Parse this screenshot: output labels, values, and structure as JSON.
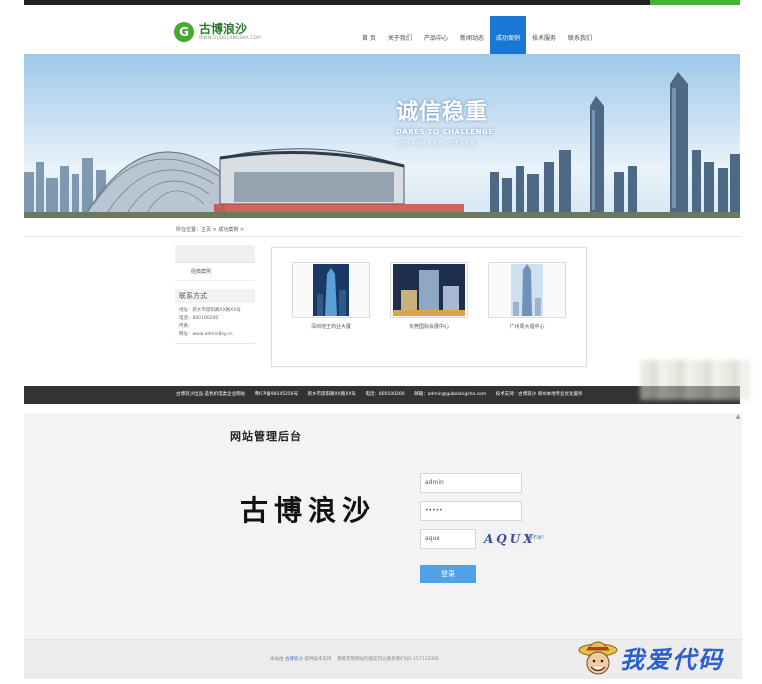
{
  "site": {
    "logo": {
      "cn": "古博浪沙",
      "en": "WWW.GUBOLANGSHA.COM",
      "mark": "G"
    },
    "nav": [
      {
        "label": "首 页",
        "active": false
      },
      {
        "label": "关于我们",
        "active": false
      },
      {
        "label": "产品中心",
        "active": false
      },
      {
        "label": "新闻动态",
        "active": false
      },
      {
        "label": "成功案例",
        "active": true
      },
      {
        "label": "技术服务",
        "active": false
      },
      {
        "label": "联系我们",
        "active": false
      }
    ],
    "banner": {
      "slogan_cn": "诚信稳重",
      "slogan_en": "DARES TO CHALLENGE",
      "tags": "• 合作 • 团结 • 发展 • 交流 • 共赢"
    },
    "breadcrumb": "所在位置：主页 > 成功案例 >",
    "sidebar": {
      "category": "经典案例",
      "contact_title": "联系方式",
      "contact_lines": [
        "地址：新乡市席阳路XX路XX号",
        "电话：800100200",
        "传真：",
        "网址：www.admin8sy.cn"
      ]
    },
    "cases": [
      {
        "caption": "深圳地王商业大厦"
      },
      {
        "caption": "东莞国际会展中心"
      },
      {
        "caption": "广州周大福中心"
      }
    ],
    "footer": [
      "古博浪沙出品-蓝色机电类企业网站",
      "粤ICP备98545256号",
      "新乡市席阳路XX路XX号",
      "电话：800100200",
      "邮箱：admin@gubolangsha.com",
      "技术支持：古博浪沙 郑州本地专业优化服务"
    ]
  },
  "admin": {
    "title": "网站管理后台",
    "logo_text": "古博浪沙",
    "username_value": "admin",
    "password_value": "•••••",
    "captcha_value": "aqux",
    "captcha_image_text": "AQUX",
    "captcha_refresh": "看不清?",
    "login_label": "登录",
    "footer": {
      "prefix": "本站由",
      "brand": "古博浪沙",
      "suffix": "提供技术支持",
      "notice": "需要定制网站的朋友可以联系我们QQ 157112306"
    }
  },
  "watermark": {
    "text": "我爱代码"
  }
}
